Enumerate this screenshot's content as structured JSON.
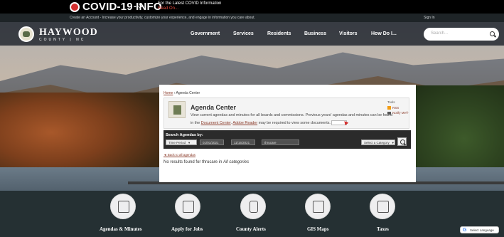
{
  "covid": {
    "title": "COVID-19 INFO",
    "arrow": "-->",
    "info_line1": "For the Latest COVID Information",
    "info_line2": "Read On..."
  },
  "account_bar": {
    "text": "Create an Account - Increase your productivity, customize your experience, and engage in information you care about.",
    "signin": "Sign In"
  },
  "logo": {
    "name": "HAYWOOD",
    "sub": "COUNTY | NC"
  },
  "nav": {
    "items": [
      "Government",
      "Services",
      "Residents",
      "Business",
      "Visitors",
      "How Do I..."
    ]
  },
  "search": {
    "placeholder": "Search..."
  },
  "agenda": {
    "breadcrumb_home": "Home",
    "breadcrumb_current": "› Agenda Center",
    "title": "Agenda Center",
    "description_1": "View current agendas and minutes for all boards and commissions. Previous years' agendas and minutes can be found in the",
    "doc_center": "Document Center",
    "dot_sep": ".",
    "adobe": "Adobe Reader",
    "description_2": "may be required to view some documents.",
    "reader_badge": "Get Adobe Reader",
    "tools_label": "Tools",
    "rss": "RSS",
    "notify": "Notify Me®"
  },
  "search_agendas": {
    "label": "Search Agendas by:",
    "time_period": "Time Period",
    "start_date": "01/01/2021",
    "end_date": "11/15/2021",
    "keyword": "thrucare",
    "category": "Select a Category"
  },
  "results": {
    "back_link": "◄ Back to all agendas",
    "prefix": "No results found for thrucare in",
    "scope": "All categories"
  },
  "quick_links": [
    {
      "label": "Agendas & Minutes",
      "icon": "stack-icon"
    },
    {
      "label": "Apply for Jobs",
      "icon": "id-card-icon"
    },
    {
      "label": "County Alerts",
      "icon": "mobile-phone-icon"
    },
    {
      "label": "GIS Maps",
      "icon": "map-icon"
    },
    {
      "label": "Taxes",
      "icon": "magnifier-document-icon"
    }
  ],
  "translate": {
    "g": "G",
    "label": "Select Language"
  }
}
